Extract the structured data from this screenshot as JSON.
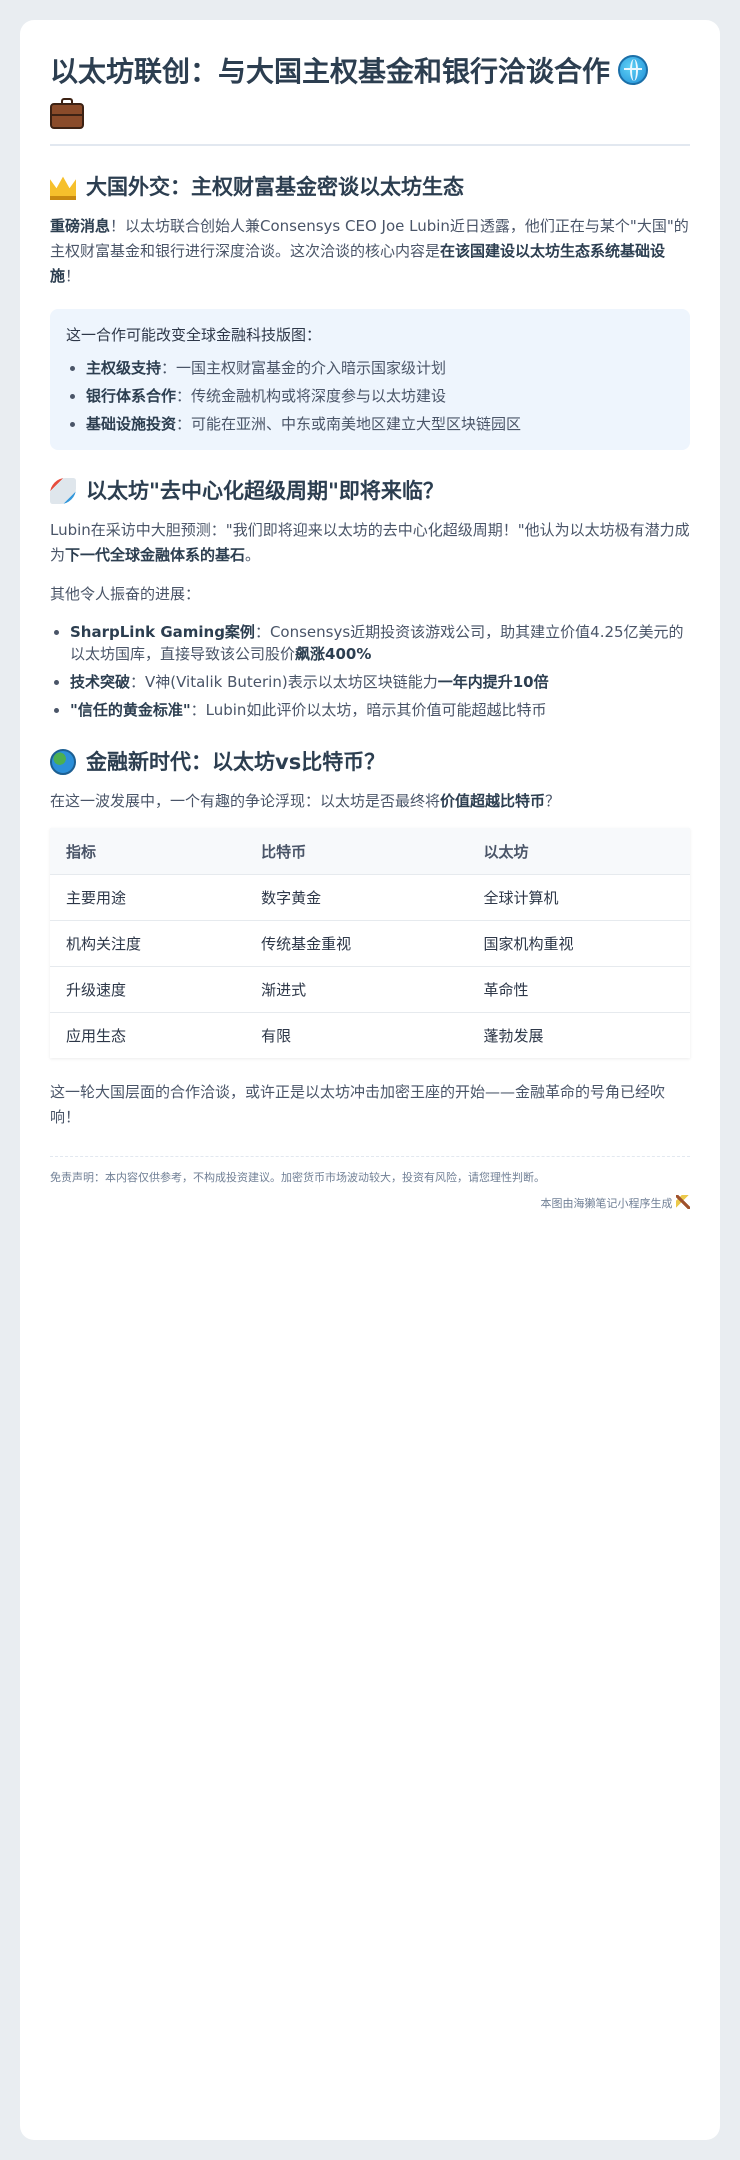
{
  "header": {
    "title": "以太坊联创：与大国主权基金和银行洽谈合作",
    "icons": [
      "globe-icon",
      "briefcase-icon"
    ]
  },
  "section1": {
    "icon": "crown-icon",
    "title": "大国外交：主权财富基金密谈以太坊生态",
    "para_bold1": "重磅消息",
    "para_text1": "！以太坊联合创始人兼Consensys CEO Joe Lubin近日透露，他们正在与某个\"大国\"的主权财富基金和银行进行深度洽谈。这次洽谈的核心内容是",
    "para_bold2": "在该国建设以太坊生态系统基础设施",
    "para_text2": "！",
    "callout": {
      "lead": "这一合作可能改变全球金融科技版图：",
      "items": [
        {
          "bold": "主权级支持",
          "text": "：一国主权财富基金的介入暗示国家级计划"
        },
        {
          "bold": "银行体系合作",
          "text": "：传统金融机构或将深度参与以太坊建设"
        },
        {
          "bold": "基础设施投资",
          "text": "：可能在亚洲、中东或南美地区建立大型区块链园区"
        }
      ]
    }
  },
  "section2": {
    "icon": "rocket-icon",
    "title": "以太坊\"去中心化超级周期\"即将来临？",
    "para_text1": "Lubin在采访中大胆预测：\"我们即将迎来以太坊的去中心化超级周期！\"他认为以太坊极有潜力成为",
    "para_bold1": "下一代全球金融体系的基石",
    "para_text2": "。",
    "sub_lead": "其他令人振奋的进展：",
    "items": [
      {
        "bold": "SharpLink Gaming案例",
        "text": "：Consensys近期投资该游戏公司，助其建立价值4.25亿美元的以太坊国库，直接导致该公司股价",
        "bold2": "飙涨400%",
        "text2": ""
      },
      {
        "bold": "技术突破",
        "text": "：V神(Vitalik Buterin)表示以太坊区块链能力",
        "bold2": "一年内提升10倍",
        "text2": ""
      },
      {
        "bold": "\"信任的黄金标准\"",
        "text": "：Lubin如此评价以太坊，暗示其价值可能超越比特币",
        "bold2": "",
        "text2": ""
      }
    ]
  },
  "section3": {
    "icon": "earth-icon",
    "title": "金融新时代：以太坊vs比特币？",
    "para_text1": "在这一波发展中，一个有趣的争论浮现：以太坊是否最终将",
    "para_bold1": "价值超越比特币",
    "para_text2": "？",
    "table": {
      "headers": [
        "指标",
        "比特币",
        "以太坊"
      ],
      "rows": [
        [
          "主要用途",
          "数字黄金",
          "全球计算机"
        ],
        [
          "机构关注度",
          "传统基金重视",
          "国家机构重视"
        ],
        [
          "升级速度",
          "渐进式",
          "革命性"
        ],
        [
          "应用生态",
          "有限",
          "蓬勃发展"
        ]
      ]
    },
    "closing": "这一轮大国层面的合作洽谈，或许正是以太坊冲击加密王座的开始——金融革命的号角已经吹响！"
  },
  "footer": {
    "disclaimer": "免责声明：本内容仅供参考，不构成投资建议。加密货币市场波动较大，投资有风险，请您理性判断。",
    "note": "本图由海獭笔记小程序生成",
    "note_icon": "pickaxe-icon"
  }
}
